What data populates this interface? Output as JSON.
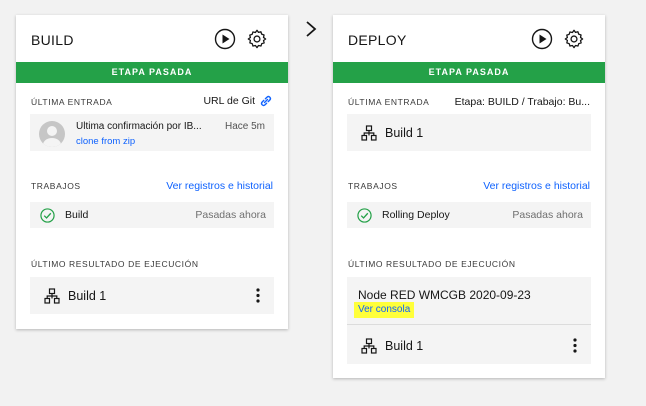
{
  "nav": {
    "chevron_icon": "chevron-right-icon"
  },
  "build": {
    "title": "BUILD",
    "status": "ETAPA PASADA",
    "last_input_label": "ÚLTIMA ENTRADA",
    "git_url_label": "URL de Git",
    "commit": {
      "message": "Última confirmación por IB...",
      "time": "Hace 5m",
      "link": "clone from zip"
    },
    "jobs_label": "TRABAJOS",
    "logs_link": "Ver registros e historial",
    "job": {
      "name": "Build",
      "status": "Pasadas ahora"
    },
    "last_result_label": "ÚLTIMO RESULTADO DE EJECUCIÓN",
    "result": {
      "name": "Build 1"
    }
  },
  "deploy": {
    "title": "DEPLOY",
    "status": "ETAPA PASADA",
    "last_input_label": "ÚLTIMA ENTRADA",
    "input_summary": "Etapa: BUILD  /  Trabajo: Bu...",
    "input_build": "Build 1",
    "jobs_label": "TRABAJOS",
    "logs_link": "Ver registros e historial",
    "job": {
      "name": "Rolling Deploy",
      "status": "Pasadas ahora"
    },
    "last_result_label": "ÚLTIMO RESULTADO DE EJECUCIÓN",
    "result": {
      "title": "Node RED WMCGB 2020-09-23",
      "console_link": "Ver consola",
      "name": "Build 1"
    }
  },
  "colors": {
    "status_green": "#24a148",
    "link_blue": "#0f62fe",
    "highlight": "#ffff3a",
    "tile_bg": "#f4f4f4"
  }
}
